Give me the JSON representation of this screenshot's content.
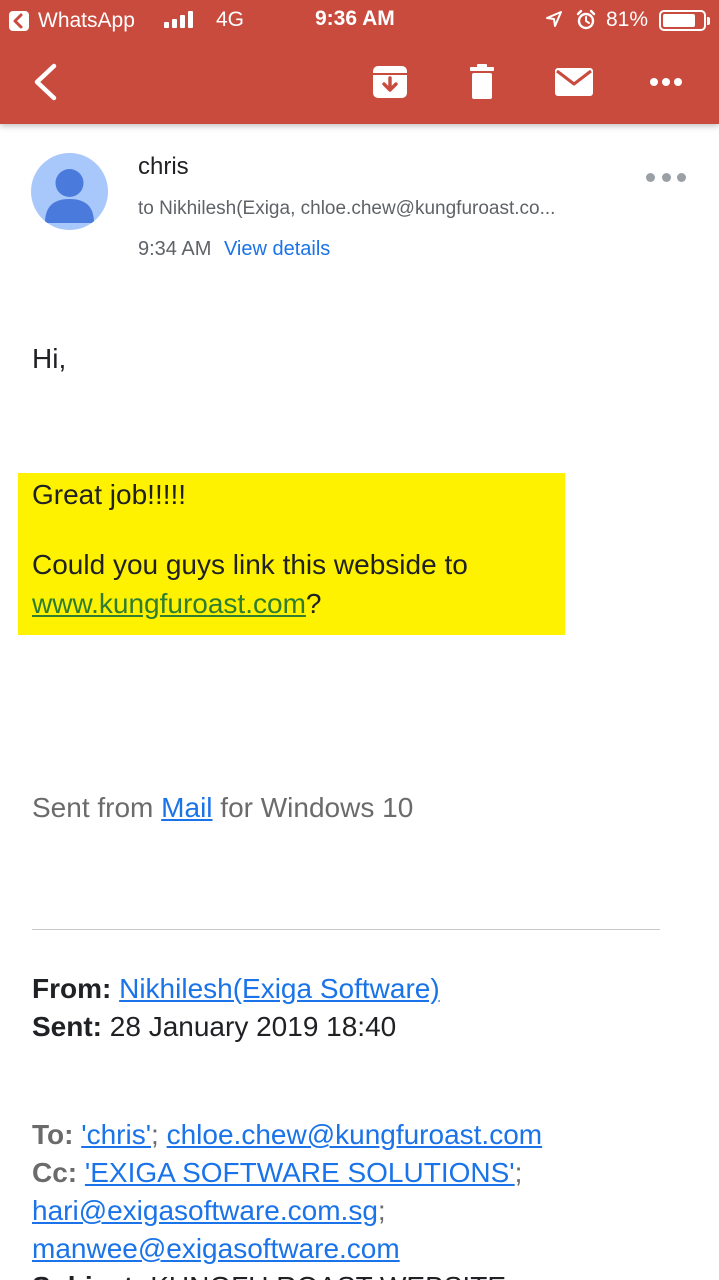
{
  "status_bar": {
    "back_app": "WhatsApp",
    "network": "4G",
    "time": "9:36 AM",
    "battery_percent": "81%",
    "battery_level": 0.81
  },
  "toolbar": {
    "back_icon": "back-arrow-icon",
    "archive_icon": "archive-icon",
    "delete_icon": "trash-icon",
    "mail_icon": "envelope-icon",
    "more_icon": "more-horizontal-icon"
  },
  "message": {
    "sender": "chris",
    "recipients": "to Nikhilesh(Exiga, chloe.chew@kungfuroast.co...",
    "time": "9:34 AM",
    "view_details": "View details"
  },
  "body": {
    "greeting": "Hi,",
    "highlight_line1": "Great job!!!!!",
    "highlight_line2_prefix": "Could you guys link this webside to ",
    "highlight_link": "www.kungfuroast.com",
    "highlight_line2_suffix": "?",
    "sent_from_prefix": "Sent from ",
    "sent_from_link": "Mail",
    "sent_from_suffix": " for Windows 10"
  },
  "quoted": {
    "from_label": "From:",
    "from_value": "Nikhilesh(Exiga Software)",
    "sent_label": "Sent:",
    "sent_value": "28 January 2019 18:40",
    "to_label": "To:",
    "to_value1": "'chris'",
    "to_sep": ";",
    "to_value2": "chloe.chew@kungfuroast.com",
    "cc_label": "Cc:",
    "cc_value1": "'EXIGA SOFTWARE SOLUTIONS'",
    "cc_sep": ";",
    "cc_value2": "hari@exigasoftware.com.sg",
    "cc_sep2": ";",
    "cc_value3": "manwee@exigasoftware.com",
    "subject_label": "Subject:",
    "subject_value": "KUNGFU ROAST WEBSITE"
  },
  "colors": {
    "appbar": "#c94b3e",
    "highlight": "#fef200",
    "link": "#1a73e8",
    "avatar_bg": "#a8c7fa",
    "avatar_fg": "#4a7bdc"
  }
}
